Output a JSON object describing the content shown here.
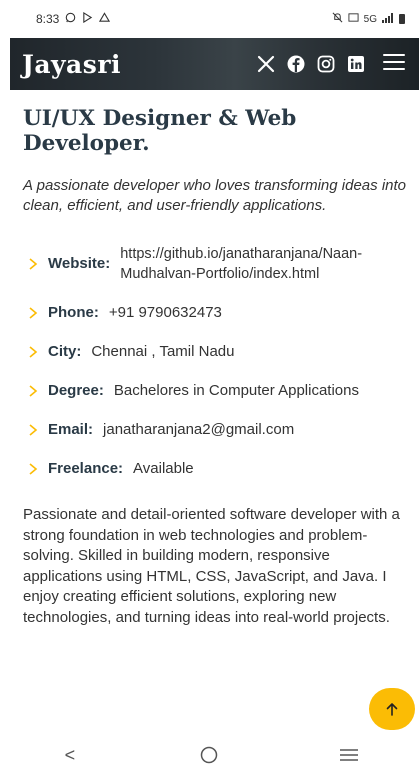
{
  "status_bar": {
    "time": "8:33",
    "network": "5G"
  },
  "header": {
    "logo": "Jayasri"
  },
  "hero": {
    "title": "UI/UX Designer & Web Developer.",
    "tagline": "A passionate developer who loves transforming ideas into clean, efficient, and user-friendly applications."
  },
  "details": [
    {
      "label": "Website:",
      "value": "https://github.io/janatharanjana/Naan-Mudhalvan-Portfolio/index.html"
    },
    {
      "label": "Phone:",
      "value": "+91 9790632473"
    },
    {
      "label": "City:",
      "value": "Chennai , Tamil Nadu"
    },
    {
      "label": "Degree:",
      "value": "Bachelores in Computer Applications"
    },
    {
      "label": "Email:",
      "value": "janatharanjana2@gmail.com"
    },
    {
      "label": "Freelance:",
      "value": "Available"
    }
  ],
  "about": "Passionate and detail-oriented software developer with a strong foundation in web technologies and problem-solving. Skilled in building modern, responsive applications using HTML, CSS, JavaScript, and Java. I enjoy creating efficient solutions, exploring new technologies, and turning ideas into real-world projects.",
  "nav": {
    "back": "<"
  },
  "colors": {
    "accent": "#fbbc05",
    "heading": "#2a3a46",
    "header_bg": "#2c343a"
  },
  "icons": {
    "social": [
      "x-icon",
      "facebook-icon",
      "instagram-icon",
      "linkedin-icon"
    ],
    "menu": "hamburger-menu-icon",
    "to_top": "arrow-up-icon",
    "detail_bullet": "chevron-right-icon"
  }
}
